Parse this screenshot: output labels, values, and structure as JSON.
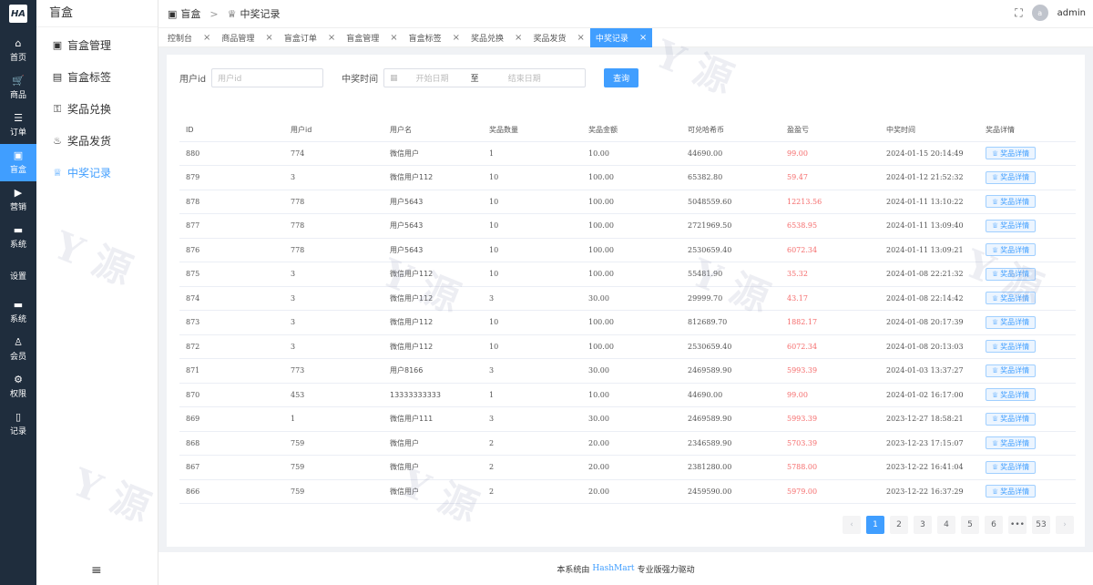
{
  "logo": "HA",
  "rail": [
    {
      "icon": "⌂",
      "label": "首页"
    },
    {
      "icon": "🛒",
      "label": "商品"
    },
    {
      "icon": "☰",
      "label": "订单"
    },
    {
      "icon": "▣",
      "label": "盲盒"
    },
    {
      "icon": "▶",
      "label": "营销"
    },
    {
      "icon": "▬",
      "label": "系统"
    },
    {
      "icon": "",
      "label": "设置"
    },
    {
      "icon": "▬",
      "label": "系统"
    },
    {
      "icon": "♙",
      "label": "会员"
    },
    {
      "icon": "⚙",
      "label": "权限"
    },
    {
      "icon": "▯",
      "label": "记录"
    }
  ],
  "submenu": {
    "title": "盲盒",
    "items": [
      {
        "icon": "▣",
        "label": "盲盒管理"
      },
      {
        "icon": "▤",
        "label": "盲盒标签"
      },
      {
        "icon": "⚿",
        "label": "奖品兑换"
      },
      {
        "icon": "♨",
        "label": "奖品发货"
      },
      {
        "icon": "♕",
        "label": "中奖记录"
      }
    ],
    "collapse_icon": "≡"
  },
  "header": {
    "crumb_root": "盲盒",
    "crumb_sep": ">",
    "crumb_current": "中奖记录",
    "avatar_letter": "a",
    "username": "admin"
  },
  "tabs": [
    "控制台",
    "商品管理",
    "盲盒订单",
    "盲盒管理",
    "盲盒标签",
    "奖品兑换",
    "奖品发货",
    "中奖记录"
  ],
  "filter": {
    "user_id_label": "用户id",
    "user_id_placeholder": "用户id",
    "time_label": "中奖时间",
    "start_placeholder": "开始日期",
    "range_sep": "至",
    "end_placeholder": "结束日期",
    "query_button": "查询"
  },
  "table": {
    "headers": [
      "ID",
      "用户id",
      "用户名",
      "奖品数量",
      "奖品金额",
      "可兑哈希币",
      "盈盈亏",
      "中奖时间",
      "奖品详情"
    ],
    "detail_label": "奖品详情",
    "rows": [
      [
        "880",
        "774",
        "微信用户",
        "1",
        "10.00",
        "44690.00",
        "99.00",
        "2024-01-15 20:14:49"
      ],
      [
        "879",
        "3",
        "微信用户112",
        "10",
        "100.00",
        "65382.80",
        "59.47",
        "2024-01-12 21:52:32"
      ],
      [
        "878",
        "778",
        "用户5643",
        "10",
        "100.00",
        "5048559.60",
        "12213.56",
        "2024-01-11 13:10:22"
      ],
      [
        "877",
        "778",
        "用户5643",
        "10",
        "100.00",
        "2721969.50",
        "6538.95",
        "2024-01-11 13:09:40"
      ],
      [
        "876",
        "778",
        "用户5643",
        "10",
        "100.00",
        "2530659.40",
        "6072.34",
        "2024-01-11 13:09:21"
      ],
      [
        "875",
        "3",
        "微信用户112",
        "10",
        "100.00",
        "55481.90",
        "35.32",
        "2024-01-08 22:21:32"
      ],
      [
        "874",
        "3",
        "微信用户112",
        "3",
        "30.00",
        "29999.70",
        "43.17",
        "2024-01-08 22:14:42"
      ],
      [
        "873",
        "3",
        "微信用户112",
        "10",
        "100.00",
        "812689.70",
        "1882.17",
        "2024-01-08 20:17:39"
      ],
      [
        "872",
        "3",
        "微信用户112",
        "10",
        "100.00",
        "2530659.40",
        "6072.34",
        "2024-01-08 20:13:03"
      ],
      [
        "871",
        "773",
        "用户8166",
        "3",
        "30.00",
        "2469589.90",
        "5993.39",
        "2024-01-03 13:37:27"
      ],
      [
        "870",
        "453",
        "13333333333",
        "1",
        "10.00",
        "44690.00",
        "99.00",
        "2024-01-02 16:17:00"
      ],
      [
        "869",
        "1",
        "微信用户111",
        "3",
        "30.00",
        "2469589.90",
        "5993.39",
        "2023-12-27 18:58:21"
      ],
      [
        "868",
        "759",
        "微信用户",
        "2",
        "20.00",
        "2346589.90",
        "5703.39",
        "2023-12-23 17:15:07"
      ],
      [
        "867",
        "759",
        "微信用户",
        "2",
        "20.00",
        "2381280.00",
        "5788.00",
        "2023-12-22 16:41:04"
      ],
      [
        "866",
        "759",
        "微信用户",
        "2",
        "20.00",
        "2459590.00",
        "5979.00",
        "2023-12-22 16:37:29"
      ]
    ]
  },
  "pagination": {
    "prev": "‹",
    "pages": [
      "1",
      "2",
      "3",
      "4",
      "5",
      "6",
      "•••",
      "53"
    ],
    "next": "›",
    "current": "1"
  },
  "footer": {
    "prefix": "本系统由",
    "link": "HashMart",
    "suffix": "专业版强力驱动"
  },
  "colors": {
    "accent": "#409eff",
    "rail_bg": "#1f2d3d",
    "loss_red": "#f56c6c"
  }
}
